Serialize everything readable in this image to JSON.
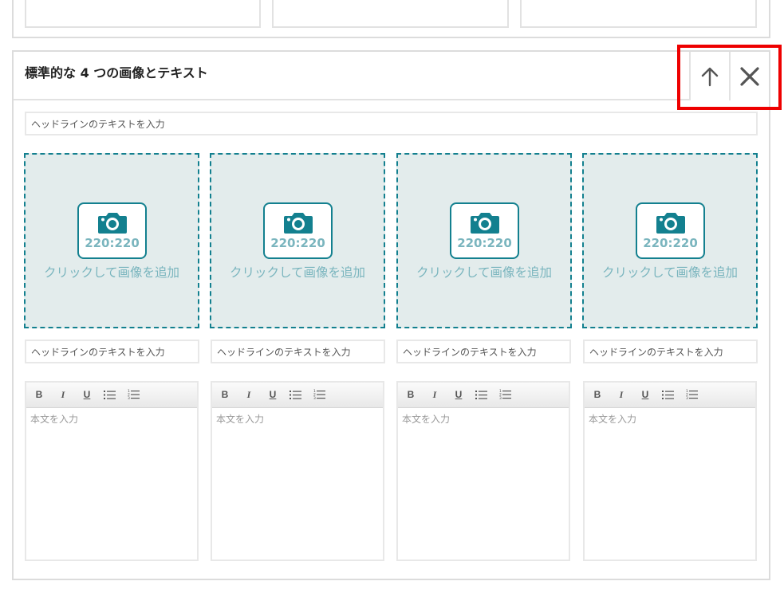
{
  "module": {
    "title": "標準的な 4 つの画像とテキスト",
    "headline_placeholder": "ヘッドラインのテキストを入力",
    "controls": {
      "move_up_icon": "arrow-up-icon",
      "remove_icon": "close-icon"
    },
    "highlight_color": "#ee0000",
    "accent_color": "#13808f"
  },
  "columns": [
    {
      "image": {
        "ratio": "220:220",
        "add_label": "クリックして画像を追加",
        "icon": "camera-icon"
      },
      "headline_placeholder": "ヘッドラインのテキストを入力",
      "body_placeholder": "本文を入力",
      "toolbar": {
        "bold": "B",
        "italic": "I",
        "underline": "U",
        "bullet_icon": "bullet-list-icon",
        "number_icon": "numbered-list-icon"
      }
    },
    {
      "image": {
        "ratio": "220:220",
        "add_label": "クリックして画像を追加",
        "icon": "camera-icon"
      },
      "headline_placeholder": "ヘッドラインのテキストを入力",
      "body_placeholder": "本文を入力",
      "toolbar": {
        "bold": "B",
        "italic": "I",
        "underline": "U",
        "bullet_icon": "bullet-list-icon",
        "number_icon": "numbered-list-icon"
      }
    },
    {
      "image": {
        "ratio": "220:220",
        "add_label": "クリックして画像を追加",
        "icon": "camera-icon"
      },
      "headline_placeholder": "ヘッドラインのテキストを入力",
      "body_placeholder": "本文を入力",
      "toolbar": {
        "bold": "B",
        "italic": "I",
        "underline": "U",
        "bullet_icon": "bullet-list-icon",
        "number_icon": "numbered-list-icon"
      }
    },
    {
      "image": {
        "ratio": "220:220",
        "add_label": "クリックして画像を追加",
        "icon": "camera-icon"
      },
      "headline_placeholder": "ヘッドラインのテキストを入力",
      "body_placeholder": "本文を入力",
      "toolbar": {
        "bold": "B",
        "italic": "I",
        "underline": "U",
        "bullet_icon": "bullet-list-icon",
        "number_icon": "numbered-list-icon"
      }
    }
  ]
}
